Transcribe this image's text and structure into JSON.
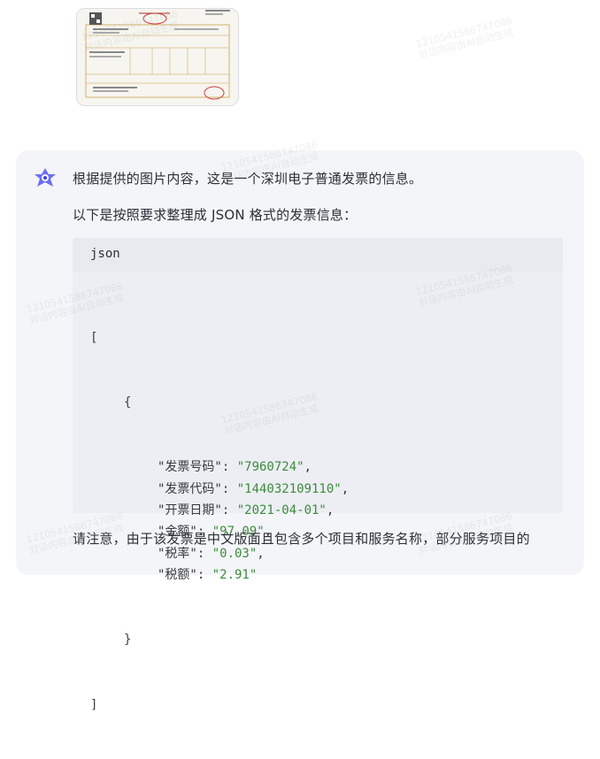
{
  "thumbnail": {
    "alt": ""
  },
  "message": {
    "intro": "根据提供的图片内容，这是一个深圳电子普通发票的信息。",
    "lead": "以下是按照要求整理成 JSON 格式的发票信息：",
    "code_lang": "json",
    "code": {
      "open_bracket": "[",
      "open_brace": "{",
      "fields": [
        {
          "key": "\"发票号码\"",
          "value": "\"7960724\"",
          "tail": ","
        },
        {
          "key": "\"发票代码\"",
          "value": "\"144032109110\"",
          "tail": ","
        },
        {
          "key": "\"开票日期\"",
          "value": "\"2021-04-01\"",
          "tail": ","
        },
        {
          "key": "\"金额\"",
          "value": "\"97.09\"",
          "tail": ","
        },
        {
          "key": "\"税率\"",
          "value": "\"0.03\"",
          "tail": ","
        },
        {
          "key": "\"税额\"",
          "value": "\"2.91\"",
          "tail": ""
        }
      ],
      "close_brace": "}",
      "close_bracket": "]"
    },
    "outro": "请注意，由于该发票是中文版面且包含多个项目和服务名称，部分服务项目的"
  },
  "watermark": {
    "line1": "12105415867470​86",
    "line2": "对话内容由AI自动生成"
  }
}
